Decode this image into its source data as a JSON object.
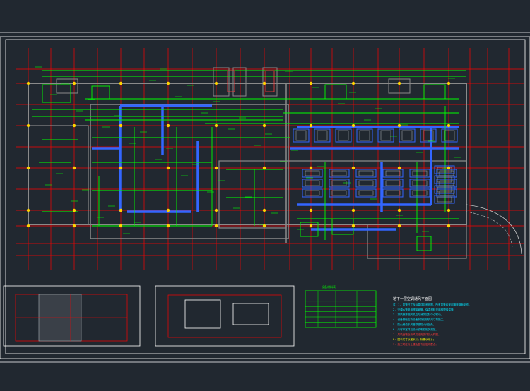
{
  "sheet": {
    "background": "#212830",
    "frame_color": "#ffffff",
    "grid_color": "#ff0000",
    "wall_color": "#8a8a8a",
    "pipe_color": "#00ff00",
    "duct_color": "#3366ff",
    "column_color": "#ffd400",
    "text_color": "#ffffff"
  },
  "legend": {
    "title": "设备材料表",
    "color": "#00ff00"
  },
  "notes": {
    "title": "地下一层空调通风平面图",
    "items": [
      {
        "text": "注：1. 风管尺寸及标高详见系统图，所有风管均采用镀锌钢板制作。",
        "color": "#00e5ff"
      },
      {
        "text": "2. 空调水管采用焊接钢管，保温材料采用橡塑保温管。",
        "color": "#00e5ff"
      },
      {
        "text": "3. 排风兼排烟风机应与消防控制中心联动。",
        "color": "#00e5ff"
      },
      {
        "text": "4. 设备基础应待设备到货后核实尺寸再施工。",
        "color": "#00e5ff"
      },
      {
        "text": "5. 防火阀设于风管穿越防火分区处。",
        "color": "#00e5ff"
      },
      {
        "text": "6. 未尽事宜详见设计说明及相关规范。",
        "color": "#00e5ff"
      },
      {
        "text": "7. 风机盘管及新风机组安装详见大样图。",
        "color": "#ff3b3b"
      },
      {
        "text": "8. 图中尺寸以毫米计，标高以米计。",
        "color": "#ffff00"
      },
      {
        "text": "9. 施工时应与土建及各专业密切配合。",
        "color": "#ff3b3b"
      }
    ]
  }
}
